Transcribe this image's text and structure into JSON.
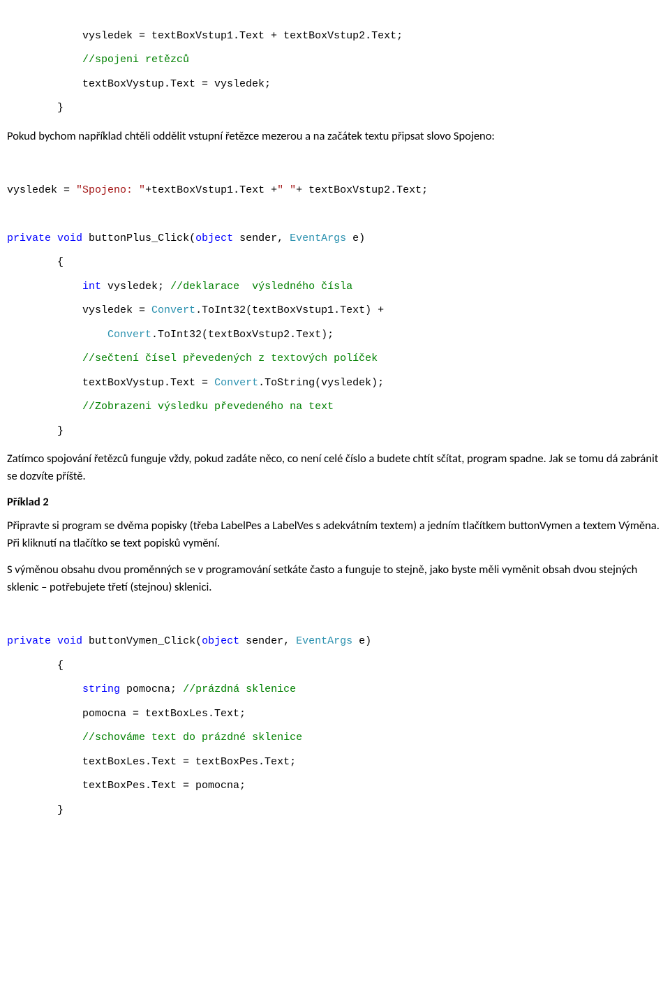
{
  "code1": {
    "l1a": "            vysledek = textBoxVstup1.Text + textBoxVstup2.Text;",
    "l2a": "            ",
    "l2b": "//spojeni retězců",
    "l3a": "            textBoxVystup.Text = vysledek;",
    "l4a": "        }"
  },
  "para1": "Pokud bychom například chtěli oddělit vstupní řetězce mezerou a na začátek textu připsat slovo Spojeno:",
  "code2": {
    "l1a": "vysledek = ",
    "l1b": "\"Spojeno: \"",
    "l1c": "+textBoxVstup1.Text +",
    "l1d": "\" \"",
    "l1e": "+ textBoxVstup2.Text;"
  },
  "code3": {
    "l1a": "private",
    "l1b": " ",
    "l1c": "void",
    "l1d": " buttonPlus_Click(",
    "l1e": "object",
    "l1f": " sender, ",
    "l1g": "EventArgs",
    "l1h": " e)",
    "l2a": "        {",
    "l3a": "            ",
    "l3b": "int",
    "l3c": " vysledek; ",
    "l3d": "//deklarace  výsledného čísla",
    "l4a": "            vysledek = ",
    "l4b": "Convert",
    "l4c": ".ToInt32(textBoxVstup1.Text) + ",
    "l5a": "                ",
    "l5b": "Convert",
    "l5c": ".ToInt32(textBoxVstup2.Text);",
    "l6a": "            ",
    "l6b": "//sečtení čísel převedených z textových políček",
    "l7a": "            textBoxVystup.Text = ",
    "l7b": "Convert",
    "l7c": ".ToString(vysledek);",
    "l8a": "            ",
    "l8b": "//Zobrazeni výsledku převedeného na text",
    "l9a": "        }"
  },
  "para2": "Zatímco  spojování řetězců funguje vždy, pokud zadáte něco, co není celé číslo a budete chtít sčítat, program spadne. Jak se tomu dá zabránit se dozvíte příště.",
  "heading1": "Příklad 2",
  "para3": "Připravte si program se dvěma popisky (třeba LabelPes a LabelVes s adekvátním textem) a jedním tlačítkem buttonVymen a textem Výměna. Při kliknutí na tlačítko se text popisků vymění.",
  "para4": "S výměnou obsahu dvou proměnných se v programování setkáte často a funguje to stejně, jako byste měli vyměnit obsah dvou stejných sklenic – potřebujete třetí (stejnou) sklenici.",
  "code4": {
    "l1a": "private",
    "l1b": " ",
    "l1c": "void",
    "l1d": " buttonVymen_Click(",
    "l1e": "object",
    "l1f": " sender, ",
    "l1g": "EventArgs",
    "l1h": " e)",
    "l2a": "        {",
    "l3a": "            ",
    "l3b": "string",
    "l3c": " pomocna; ",
    "l3d": "//prázdná sklenice",
    "l4a": "            pomocna = textBoxLes.Text;",
    "l5a": "            ",
    "l5b": "//schováme text do prázdné sklenice",
    "l6a": "            textBoxLes.Text = textBoxPes.Text;",
    "l7a": "            textBoxPes.Text = pomocna;",
    "l8a": "        }"
  }
}
